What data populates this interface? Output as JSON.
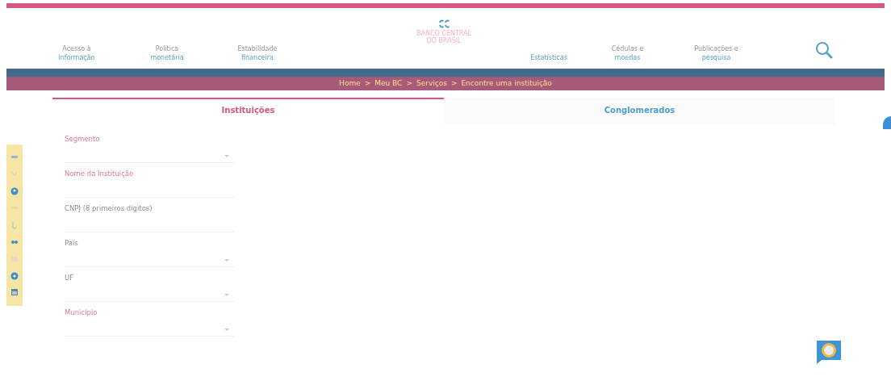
{
  "header": {
    "nav_left": [
      {
        "line1": "Acesso à",
        "line2": "informação"
      },
      {
        "line1": "Política",
        "line2": "monetária"
      },
      {
        "line1": "Estabilidade",
        "line2": "financeira"
      }
    ],
    "logo": {
      "name": "BANCO CENTRAL",
      "sub": "DO BRASIL"
    },
    "nav_right": [
      {
        "line2": "Estatísticas"
      },
      {
        "line1": "Cédulas e",
        "line2": "moedas"
      },
      {
        "line1": "Publicações e",
        "line2": "pesquisa"
      }
    ]
  },
  "breadcrumb": {
    "separator": ">",
    "items": [
      "Home",
      "Meu BC",
      "Serviços",
      "Encontre uma instituição"
    ]
  },
  "tabs": [
    {
      "label": "Instituições",
      "selected": true
    },
    {
      "label": "Conglomerados",
      "selected": false
    }
  ],
  "form": {
    "fields": [
      {
        "label": "Segmento",
        "kind": "select",
        "required": true
      },
      {
        "label": "Nome da Instituição",
        "kind": "input",
        "required": true
      },
      {
        "label": "CNPJ (8 primeiros dígitos)",
        "kind": "input",
        "required": false
      },
      {
        "label": "País",
        "kind": "select",
        "required": false
      },
      {
        "label": "UF",
        "kind": "select",
        "required": false
      },
      {
        "label": "Município",
        "kind": "select",
        "required": true
      }
    ]
  }
}
